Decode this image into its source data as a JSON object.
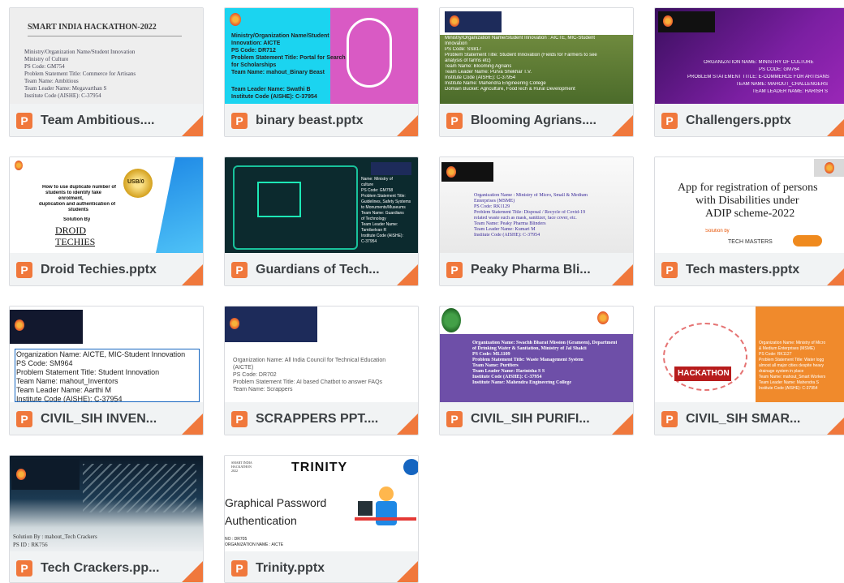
{
  "files": [
    {
      "name": "Team Ambitious....",
      "thumb_title": "SMART INDIA HACKATHON-2022",
      "thumb_lines": [
        "Ministry/Organization Name/Student Innovation",
        "Ministry of Culture",
        "PS Code: GM754",
        "Problem Statement Title: Commerce for Artisans",
        "Team Name: Ambitious",
        "Team Leader Name: Megavarthan S",
        "Institute Code (AISHE): C-37954"
      ]
    },
    {
      "name": "binary beast.pptx",
      "thumb_lines": [
        "Ministry/Organization Name/Student",
        "Innovation: AICTE",
        "PS Code: DR712",
        "Problem Statement Title: Portal for Search",
        "for Scholarships",
        "Team Name: mahout_Binary Beast",
        "Team Leader Name: Swathi B",
        "Institute Code (AISHE): C-37954"
      ]
    },
    {
      "name": "Blooming Agrians....",
      "thumb_lines": [
        "Ministry/Organization Name/Student Innovation : AICTE, MIC-Student",
        "Innovation",
        "PS Code: SS817",
        "Problem Statement Title: Student Innovation (Fields for Farmers to see",
        "analysis of farms etc)",
        "Team Name: Blooming Agrians",
        "Team Leader Name: Purva Shekhar T.V.",
        "Institute Code (AISHE): C-37954",
        "Institute Name: Mahendra Engineering College",
        "Domain Bucket: Agriculture, FoodTech & Rural Development"
      ]
    },
    {
      "name": "Challengers.pptx",
      "thumb_lines": [
        "ORGANIZATION NAME: MINISTRY OF CULTURE",
        "PS CODE: GM764",
        "PROBLEM STATEMENT TITLE: E-COMMERCE FOR ARTISANS",
        "TEAM NAME: MAHOUT_CHALLENGERS",
        "TEAM LEADER NAME: HARISH S"
      ]
    },
    {
      "name": "Droid Techies.pptx",
      "thumb_lines": [
        "How to use duplicate number of",
        "students to identify fake",
        "enrolment,",
        "duplication and authentication of",
        "students",
        "Solution By",
        "DROID",
        "TECHIES"
      ],
      "badge": "USB/0"
    },
    {
      "name": "Guardians of Tech...",
      "thumb_lines": [
        "Name: Ministry of",
        "culture",
        "PS Code: GM758",
        "Problem Statement Title:",
        "Guidelines, Safety Systems",
        "to Monuments/Museums",
        "Team Name: Guardians",
        "of Technology",
        "Team Leader Name:",
        "Tamilselvan R",
        "Institute Code (AISHE):",
        "C-37954"
      ]
    },
    {
      "name": "Peaky Pharma Bli...",
      "thumb_lines": [
        "Organization Name : Ministry of Micro, Small & Medium",
        "Enterprises (MSME)",
        "PS Code: RK1129",
        "Problem Statement Title: Disposal / Recycle of Covid-19",
        "related waste such as mask, sanitizer, face cover, etc.",
        "Team Name: Peaky Pharma Blinders",
        "Team Leader Name: Kumari M",
        "Institute Code (AISHE): C-37954"
      ]
    },
    {
      "name": "Tech masters.pptx",
      "thumb_lines": [
        "App for registration of persons",
        "with Disabilities under",
        "ADIP scheme-2022",
        "Solution by",
        "TECH MASTERS"
      ]
    },
    {
      "name": "CIVIL_SIH INVEN...",
      "thumb_lines": [
        "Organization Name: AICTE, MIC-Student Innovation",
        "PS Code: SM964",
        "Problem Statement Title: Student Innovation",
        "Team Name: mahout_Inventors",
        "Team Leader Name: Aarthi M",
        "Institute Code (AISHE): C-37954"
      ]
    },
    {
      "name": "SCRAPPERS PPT....",
      "thumb_lines": [
        "Organization Name: All India Council for Technical Education",
        "(AICTE)",
        "PS Code: DR702",
        "Problem Statement Title: AI based Chatbot to answer FAQs",
        "Team Name: Scrappers"
      ]
    },
    {
      "name": "CIVIL_SIH PURIFI...",
      "thumb_lines": [
        "Organization Name: Swachh Bharat Mission (Grameen), Department",
        "of Drinking Water & Sanitation, Ministry of Jal Shakti",
        "PS Code: ML1109",
        "Problem Statement Title: Waste Management System",
        "Team Name: Purifiers",
        "Team Leader Name: Harinisha S S",
        "Institute Code (AISHE): C-37954",
        "Institute Name: Mahendra Engineering College"
      ]
    },
    {
      "name": "CIVIL_SIH SMAR...",
      "thumb_badge": "HACKATHON",
      "thumb_lines": [
        "Organization Name: Ministry of Micro",
        "& Medium Enterprises (MSME)",
        "PS Code: RK1127",
        "Problem Statement Title: Water logg",
        "almost all major cities despite heavy",
        "drainage system in place",
        "Team Name: mahout_Smart Workers",
        "Team Leader Name: Mahendra S",
        "Institute Code (AISHE): C-37954"
      ]
    },
    {
      "name": "Tech Crackers.pp...",
      "thumb_lines": [
        "Solution By : mahout_Tech Crackers",
        "PS ID : RK756"
      ]
    },
    {
      "name": "Trinity.pptx",
      "thumb_title": "TRINITY",
      "thumb_lines": [
        "Graphical Password",
        "Authentication",
        "NO : DR705",
        "ORGANIZATION NAME : AICTE"
      ]
    }
  ],
  "icon": "P",
  "colors": {
    "accent": "#f0783c",
    "footer": "#f1f3f4",
    "border": "#dadce0",
    "text": "#3c4043"
  }
}
